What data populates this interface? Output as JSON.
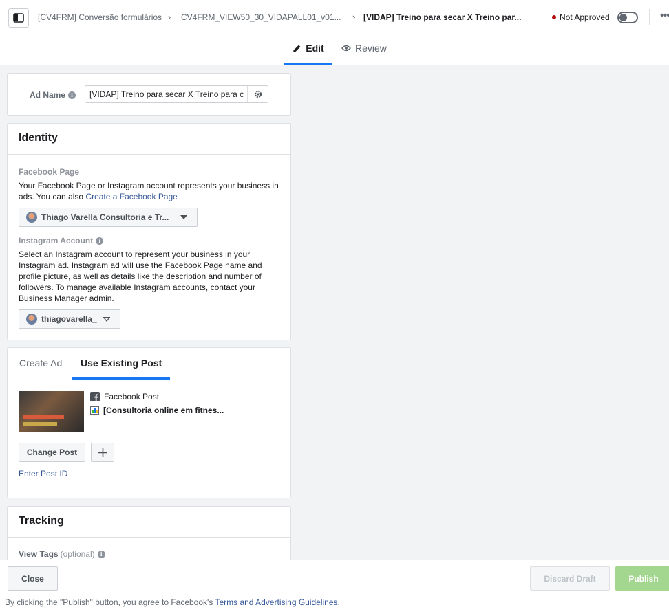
{
  "breadcrumb": {
    "campaign": "[CV4FRM] Conversão formulários",
    "adset": "CV4FRM_VIEW50_30_VIDAPALL01_v01...",
    "ad": "[VIDAP] Treino para secar X Treino par..."
  },
  "status": {
    "label": "Not Approved",
    "dot_color": "#b20b0b"
  },
  "tabs": {
    "edit": "Edit",
    "review": "Review"
  },
  "ad_name": {
    "label": "Ad Name",
    "value": "[VIDAP] Treino para secar X Treino para c"
  },
  "identity": {
    "title": "Identity",
    "facebook_page": {
      "label": "Facebook Page",
      "description": "Your Facebook Page or Instagram account represents your business in ads. You can also ",
      "link": "Create a Facebook Page",
      "selected": "Thiago Varella Consultoria e Tr..."
    },
    "instagram": {
      "label": "Instagram Account",
      "description": "Select an Instagram account to represent your business in your Instagram ad. Instagram ad will use the Facebook Page name and profile picture, as well as details like the description and number of followers. To manage available Instagram accounts, contact your Business Manager admin.",
      "selected": "thiagovarella_"
    }
  },
  "post": {
    "tab_create": "Create Ad",
    "tab_existing": "Use Existing Post",
    "source": "Facebook Post",
    "title": "[Consultoria online em fitnes...",
    "change_button": "Change Post",
    "enter_id": "Enter Post ID"
  },
  "tracking": {
    "title": "Tracking",
    "view_tags": "View Tags",
    "optional": "(optional)"
  },
  "footer": {
    "close": "Close",
    "discard": "Discard Draft",
    "publish": "Publish",
    "legal_prefix": "By clicking the \"Publish\" button, you agree to Facebook's ",
    "legal_link": "Terms and Advertising Guidelines",
    "legal_suffix": "."
  },
  "colors": {
    "accent": "#1877f2",
    "publish": "#a3d68f",
    "link": "#365899"
  }
}
